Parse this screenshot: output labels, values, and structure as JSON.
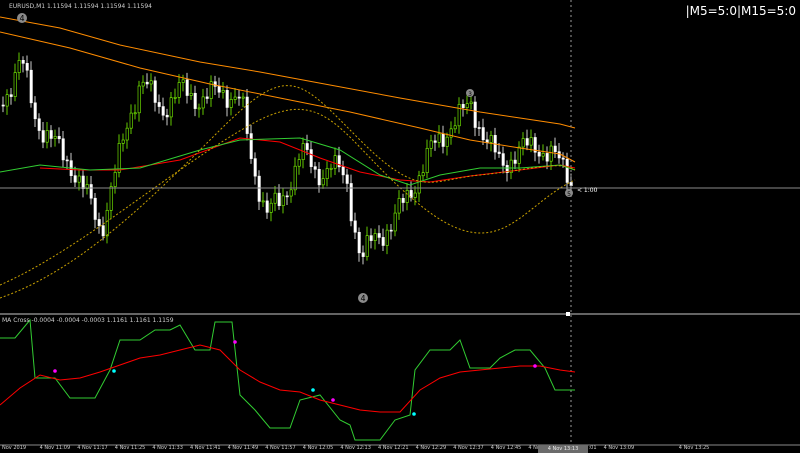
{
  "chart": {
    "symbol_header": "EURUSD,M1  1.11594 1.11594 1.11594 1.11594",
    "indicator_header": "MA Cross -0.0004 -0.0004 -0.0003   1.1161 1.1161 1.1159",
    "mtf_status": "|M5=5:0|M15=5:0",
    "countdown": "< 1:00",
    "time_cursor_label": "4 Nov 13:13",
    "wave_markers": [
      "4",
      "3",
      "4",
      "5"
    ],
    "time_ticks": [
      "Nov 2019",
      "4 Nov 11:09",
      "4 Nov 11:17",
      "4 Nov 11:25",
      "4 Nov 11:33",
      "4 Nov 11:41",
      "4 Nov 11:49",
      "4 Nov 11:57",
      "4 Nov 12:05",
      "4 Nov 12:13",
      "4 Nov 12:21",
      "4 Nov 12:29",
      "4 Nov 12:37",
      "4 Nov 12:45",
      "4 Nov 12:53",
      "4 Nov 13:01",
      "4 Nov 13:09",
      "4 Nov 13:13",
      "4 Nov 13:25"
    ]
  },
  "colors": {
    "bull_candle": "#7cfc00",
    "bear_candle": "#ffffff",
    "ma_orange": "#ff8c00",
    "ma_red": "#ff0000",
    "ma_green": "#32cd32",
    "ma_dotted": "#c8a000",
    "signal_magenta": "#ff00ff",
    "signal_cyan": "#00ffff"
  }
}
